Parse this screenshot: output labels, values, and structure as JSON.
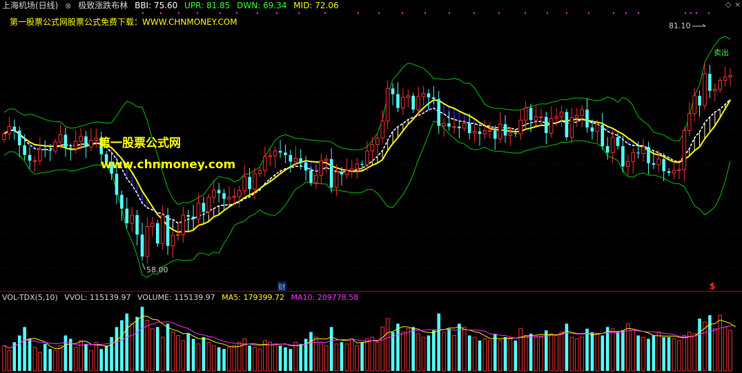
{
  "header": {
    "symbol": "上海机场(日线)",
    "indicator_name": "极致涨跌布林",
    "bbi": "BBI: 75.60",
    "upr": "UPR: 81.85",
    "dwn": "DWN: 69.34",
    "mid": "MID: 72.06"
  },
  "colors": {
    "up": "#ff3232",
    "down": "#54ffff",
    "upr_line": "#00c800",
    "mid_line": "#ffff00",
    "bbi_line": "#ffffff",
    "bear_fill": "#1a1aa8",
    "bull_fill": "#ffffd0",
    "ma5": "#ffff00",
    "ma10": "#ff33ff",
    "hdr_upr": "#33ff33",
    "hdr_mid": "#ffff00"
  },
  "promo_text": "第一股票公式网股票公式免费下载：WWW.CHNMONEY.COM",
  "watermark": {
    "line1": "第一股票公式网",
    "line2": "www.chnmoney.com"
  },
  "price_labels": {
    "high": "81.10",
    "low": "58.00"
  },
  "markers": {
    "finance_badge": "财",
    "dividend_badge": "$",
    "sell_signal": "卖出"
  },
  "volume_header": {
    "name": "VOL-TDX(5,10)",
    "vvol": "VVOL: 115139.97",
    "volume": "VOLUME: 115139.97",
    "ma5": "MA5: 179399.72",
    "ma10": "MA10: 209778.58"
  },
  "chart_data": {
    "type": "candlestick",
    "price_ylim": [
      56,
      87
    ],
    "volume_ylim": [
      0,
      400000
    ],
    "open": [
      73.2,
      73.9,
      74.8,
      74.3,
      72.5,
      71.3,
      70.6,
      70.6,
      72,
      71.9,
      71.8,
      72.9,
      73.8,
      72.2,
      72.1,
      73,
      73.6,
      72.3,
      73.1,
      73.4,
      71.4,
      70.4,
      69,
      66.4,
      64.7,
      62.9,
      63.9,
      61.5,
      58.8,
      62.5,
      62.9,
      60.4,
      63.9,
      60.1,
      61.4,
      61.5,
      63.9,
      63.7,
      63.4,
      65.4,
      64.3,
      66.1,
      67,
      66.6,
      65.9,
      66.1,
      66.2,
      66.9,
      68.6,
      67.1,
      69,
      69.4,
      71.1,
      71.2,
      71.8,
      71.6,
      71.3,
      70.5,
      70.9,
      70.4,
      69.4,
      67.9,
      68.8,
      70.6,
      70.8,
      67.3,
      69.2,
      68.9,
      69.4,
      69.6,
      70.2,
      70.1,
      71.8,
      72.6,
      73.4,
      75.5,
      79.5,
      78.8,
      77.1,
      78.4,
      78.6,
      76.9,
      78.5,
      78.9,
      78.4,
      78.2,
      74.9,
      75.2,
      74.8,
      74.8,
      74.6,
      75.2,
      74,
      74.2,
      73.9,
      74.3,
      74.3,
      73.3,
      75.1,
      73.7,
      74,
      73.9,
      75.6,
      77.1,
      75.6,
      76,
      76,
      74,
      75.8,
      76,
      76.6,
      73.5,
      75.9,
      76.2,
      76.9,
      74.7,
      74.2,
      75,
      72.4,
      71.6,
      73.5,
      72.4,
      69.9,
      70.5,
      71.6,
      71.5,
      72.3,
      70.3,
      70.1,
      70.8,
      69.3,
      69.1,
      69.4,
      69.5,
      74.3,
      76.4,
      78.6,
      77.4,
      81.3,
      79.2,
      79.4,
      80.5,
      80.9
    ],
    "close": [
      73.9,
      74.8,
      74.3,
      72.5,
      71.3,
      70.6,
      70.6,
      72,
      71.9,
      71.8,
      72.9,
      73.8,
      72.2,
      72.1,
      73,
      73.6,
      72.3,
      73.1,
      73.4,
      71.4,
      70.4,
      69,
      66.4,
      64.7,
      62.9,
      63.9,
      61.5,
      58.8,
      62.5,
      62.9,
      60.4,
      63.9,
      60.1,
      61.4,
      61.5,
      63.9,
      63.7,
      63.4,
      65.4,
      64.3,
      66.1,
      67,
      66.6,
      65.9,
      66.1,
      66.2,
      66.9,
      68.6,
      67.1,
      69,
      69.4,
      71.1,
      71.2,
      71.8,
      71.6,
      71.3,
      70.5,
      70.9,
      70.4,
      69.4,
      67.9,
      68.8,
      70.6,
      70.8,
      67.3,
      69.2,
      68.9,
      69.4,
      69.6,
      70.2,
      70.1,
      71.8,
      72.6,
      73.4,
      75.5,
      79.5,
      78.8,
      77.1,
      78.4,
      78.6,
      76.9,
      78.5,
      78.9,
      78.4,
      78.2,
      74.9,
      75.2,
      74.8,
      74.8,
      74.6,
      75.2,
      74,
      74.2,
      73.9,
      74.3,
      74.3,
      73.3,
      75.1,
      73.7,
      74,
      73.9,
      75.6,
      77.1,
      75.6,
      76,
      76,
      74,
      75.8,
      76,
      76.6,
      73.5,
      75.9,
      76.2,
      76.9,
      74.7,
      74.2,
      75,
      72.4,
      71.6,
      73.5,
      72.4,
      69.9,
      70.5,
      71.6,
      71.5,
      72.3,
      70.3,
      70.1,
      70.8,
      69.3,
      69.1,
      69.4,
      69.5,
      74.3,
      76.4,
      78.6,
      77.4,
      81.3,
      79.2,
      79.4,
      80.5,
      80.9,
      81.1
    ],
    "volume": [
      150000,
      120000,
      170000,
      210000,
      260000,
      190000,
      140000,
      110000,
      160000,
      130000,
      120000,
      150000,
      210000,
      190000,
      140000,
      180000,
      160000,
      120000,
      170000,
      130000,
      150000,
      200000,
      260000,
      300000,
      340000,
      280000,
      320000,
      380000,
      300000,
      250000,
      260000,
      200000,
      280000,
      230000,
      210000,
      180000,
      220000,
      190000,
      160000,
      200000,
      170000,
      150000,
      140000,
      130000,
      140000,
      150000,
      170000,
      190000,
      150000,
      140000,
      130000,
      180000,
      170000,
      160000,
      150000,
      140000,
      130000,
      170000,
      160000,
      190000,
      230000,
      200000,
      170000,
      150000,
      260000,
      160000,
      170000,
      160000,
      190000,
      150000,
      170000,
      190000,
      200000,
      170000,
      260000,
      310000,
      230000,
      280000,
      230000,
      250000,
      260000,
      220000,
      200000,
      210000,
      240000,
      340000,
      230000,
      250000,
      210000,
      280000,
      260000,
      210000,
      200000,
      180000,
      190000,
      180000,
      220000,
      180000,
      200000,
      190000,
      180000,
      250000,
      210000,
      220000,
      200000,
      200000,
      240000,
      220000,
      210000,
      230000,
      280000,
      200000,
      190000,
      200000,
      250000,
      230000,
      220000,
      210000,
      260000,
      250000,
      230000,
      240000,
      280000,
      240000,
      210000,
      200000,
      190000,
      210000,
      230000,
      200000,
      200000,
      190000,
      180000,
      210000,
      230000,
      220000,
      310000,
      290000,
      330000,
      250000,
      330000,
      260000,
      240000,
      220000
    ],
    "annotations": {
      "high_value": 81.1,
      "low_value": 58.0
    }
  }
}
